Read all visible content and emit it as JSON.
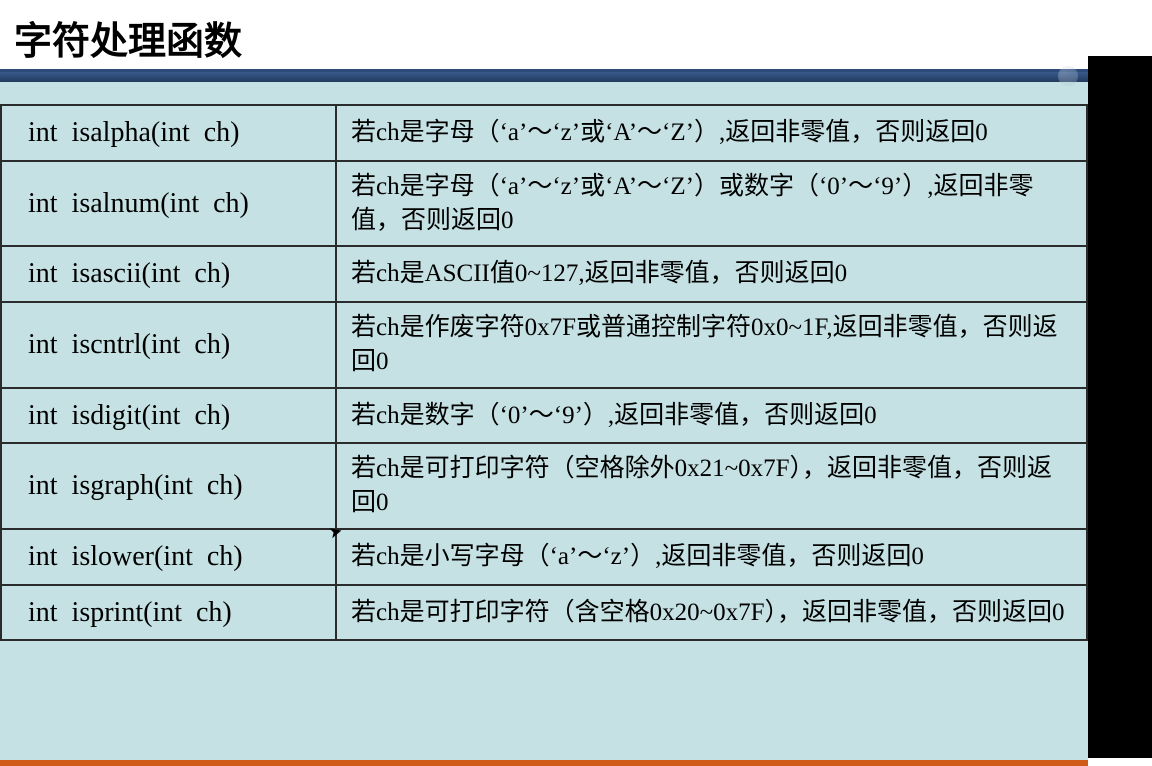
{
  "title": "字符处理函数",
  "rows": [
    {
      "sig": "int  isalpha(int  ch)",
      "desc": "若ch是字母（‘a’～‘z’或‘A’～‘Z’）,返回非零值，否则返回0"
    },
    {
      "sig": "int  isalnum(int  ch)",
      "desc": "若ch是字母（‘a’～‘z’或‘A’～‘Z’）或数字（‘0’～‘9’）,返回非零值，否则返回0"
    },
    {
      "sig": "int  isascii(int  ch)",
      "desc": "若ch是ASCII值0~127,返回非零值，否则返回0"
    },
    {
      "sig": "int  iscntrl(int  ch)",
      "desc": "若ch是作废字符0x7F或普通控制字符0x0~1F,返回非零值，否则返回0"
    },
    {
      "sig": "int  isdigit(int  ch)",
      "desc": "若ch是数字（‘0’～‘9’）,返回非零值，否则返回0"
    },
    {
      "sig": "int  isgraph(int  ch)",
      "desc": "若ch是可打印字符（空格除外0x21~0x7F），返回非零值，否则返回0"
    },
    {
      "sig": "int  islower(int  ch)",
      "desc": "若ch是小写字母（‘a’～‘z’）,返回非零值，否则返回0"
    },
    {
      "sig": "int  isprint(int  ch)",
      "desc": "若ch是可打印字符（含空格0x20~0x7F），返回非零值，否则返回0"
    }
  ]
}
